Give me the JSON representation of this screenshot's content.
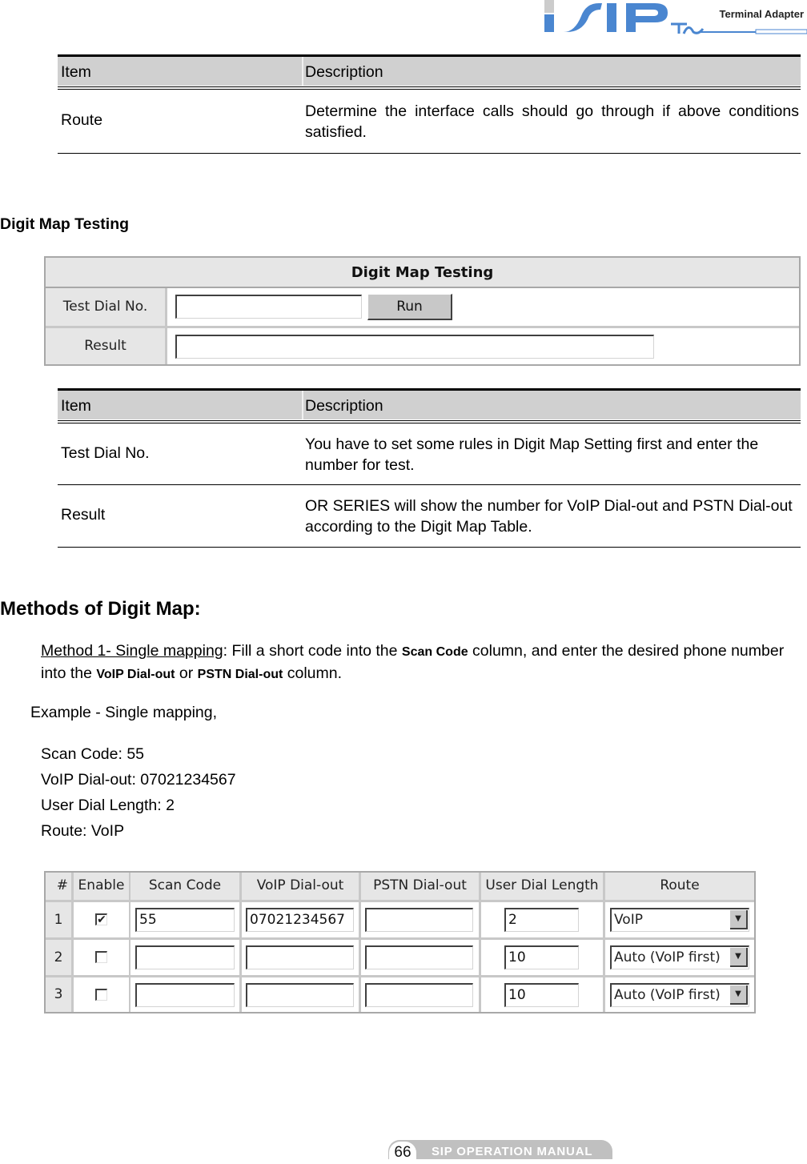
{
  "header": {
    "logo_text": "SIP TA",
    "title": "Terminal Adapter",
    "colors": {
      "brand_blue": "#4a86d0",
      "brand_gray": "#cccccc"
    }
  },
  "route_table": {
    "headers": [
      "Item",
      "Description"
    ],
    "rows": [
      {
        "item": "Route",
        "description": "Determine the interface calls should go through if above conditions satisfied."
      }
    ]
  },
  "digit_map_testing": {
    "section_title": "Digit Map Testing",
    "panel": {
      "title": "Digit Map Testing",
      "test_dial_label": "Test Dial No.",
      "test_dial_value": "",
      "run_button": "Run",
      "result_label": "Result",
      "result_value": ""
    },
    "table": {
      "headers": [
        "Item",
        "Description"
      ],
      "rows": [
        {
          "item": "Test Dial No.",
          "description": "You have to set some rules in Digit Map Setting first and enter the number for test."
        },
        {
          "item": "Result",
          "description": "OR SERIES will show the number for VoIP Dial-out and PSTN Dial-out according to the Digit Map Table."
        }
      ]
    }
  },
  "methods": {
    "title": "Methods of Digit Map:",
    "method1": {
      "link": "Method 1- Single mapping",
      "t1": ": Fill a short code into the ",
      "b1": "Scan Code",
      "t2": " column, and enter the desired phone number into the ",
      "b2": "VoIP Dial-out",
      "t3": " or ",
      "b3": "PSTN Dial-out",
      "t4": " column."
    },
    "example_title": "Example - Single mapping,",
    "example_lines": [
      "Scan Code: 55",
      "VoIP Dial-out: 07021234567",
      "User Dial Length: 2",
      "Route: VoIP"
    ]
  },
  "digit_map_grid": {
    "headers": [
      "#",
      "Enable",
      "Scan Code",
      "VoIP Dial-out",
      "PSTN Dial-out",
      "User Dial Length",
      "Route"
    ],
    "rows": [
      {
        "num": "1",
        "enabled": "✔",
        "scan_code": "55",
        "voip": "07021234567",
        "pstn": "",
        "length": "2",
        "route": "VoIP"
      },
      {
        "num": "2",
        "enabled": "",
        "scan_code": "",
        "voip": "",
        "pstn": "",
        "length": "10",
        "route": "Auto (VoIP first)"
      },
      {
        "num": "3",
        "enabled": "",
        "scan_code": "",
        "voip": "",
        "pstn": "",
        "length": "10",
        "route": "Auto (VoIP first)"
      }
    ]
  },
  "footer": {
    "page_number": "66",
    "manual_title": "SIP OPERATION MANUAL"
  }
}
